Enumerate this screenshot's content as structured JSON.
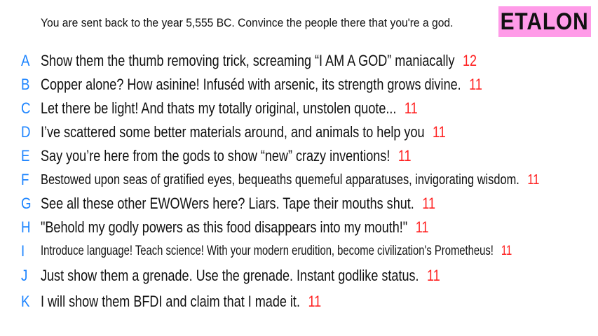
{
  "prompt": "You are sent back to the year 5,555 BC. Convince the people there that you're a god.",
  "badge": {
    "label": "ETALON",
    "color": "#ff9be8"
  },
  "colors": {
    "letter": "#1c84ff",
    "score": "#ff2020",
    "text": "#111111"
  },
  "responses": [
    {
      "letter": "A",
      "text": "Show them the thumb removing trick, screaming “I AM A GOD” maniacally",
      "score": "12"
    },
    {
      "letter": "B",
      "text": "Copper alone? How asinine! Infuséd with arsenic, its strength grows divine.",
      "score": "11"
    },
    {
      "letter": "C",
      "text": "Let there be light! And thats my totally original, unstolen quote...",
      "score": "11"
    },
    {
      "letter": "D",
      "text": "I’ve scattered some better materials around, and animals to help you",
      "score": "11"
    },
    {
      "letter": "E",
      "text": "Say you’re here from the gods to show “new” crazy inventions!",
      "score": "11"
    },
    {
      "letter": "F",
      "text": "Bestowed upon seas of gratified eyes, bequeaths quemeful apparatuses, invigorating wisdom.",
      "score": "11"
    },
    {
      "letter": "G",
      "text": "See all these other EWOWers here? Liars. Tape their mouths shut.",
      "score": "11"
    },
    {
      "letter": "H",
      "text": "\"Behold my godly powers as this food disappears into my mouth!\"",
      "score": "11"
    },
    {
      "letter": "I",
      "text": "Introduce language! Teach science! With your modern erudition, become civilization's Prometheus!",
      "score": "11"
    },
    {
      "letter": "J",
      "text": "Just show them a grenade. Use the grenade. Instant godlike status.",
      "score": "11"
    },
    {
      "letter": "K",
      "text": "I will show them BFDI and claim that I made it.",
      "score": "11"
    }
  ]
}
